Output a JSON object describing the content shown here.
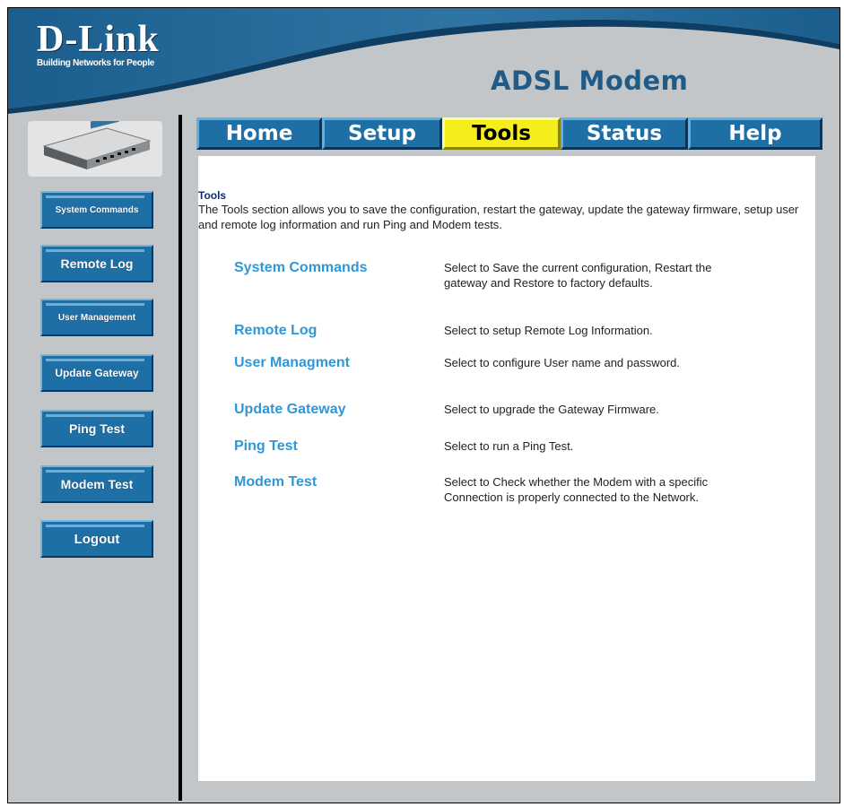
{
  "header": {
    "brand": "D-Link",
    "tagline": "Building Networks for People",
    "product_title": "ADSL Modem"
  },
  "tabs": [
    {
      "label": "Home",
      "active": false
    },
    {
      "label": "Setup",
      "active": false
    },
    {
      "label": "Tools",
      "active": true
    },
    {
      "label": "Status",
      "active": false
    },
    {
      "label": "Help",
      "active": false
    }
  ],
  "sidebar": {
    "device_image": "router-device-icon",
    "buttons": [
      {
        "label": "System Commands"
      },
      {
        "label": "Remote Log"
      },
      {
        "label": "User Management"
      },
      {
        "label": "Update Gateway"
      },
      {
        "label": "Ping Test"
      },
      {
        "label": "Modem Test"
      },
      {
        "label": "Logout"
      }
    ]
  },
  "main": {
    "section_title": "Tools",
    "section_desc": "The Tools section allows you to save the configuration, restart the gateway, update the gateway firmware, setup user and remote log information and run Ping and Modem tests.",
    "items": [
      {
        "link": "System Commands",
        "desc": "Select to Save the current configuration, Restart the gateway and Restore to factory defaults."
      },
      {
        "link": "Remote Log",
        "desc": "Select to setup Remote Log Information."
      },
      {
        "link": "User Managment",
        "desc": "Select to configure User name and password."
      },
      {
        "link": "Update Gateway",
        "desc": "Select to upgrade the Gateway Firmware."
      },
      {
        "link": "Ping Test",
        "desc": "Select to run a Ping Test."
      },
      {
        "link": "Modem Test",
        "desc": "Select to Check whether the Modem with a specific Connection is properly connected to the Network."
      }
    ]
  },
  "colors": {
    "brand_blue": "#1e6fa6",
    "active_tab": "#f6ee1c",
    "link_blue": "#2f97d8",
    "background_gray": "#c3c6c9"
  }
}
